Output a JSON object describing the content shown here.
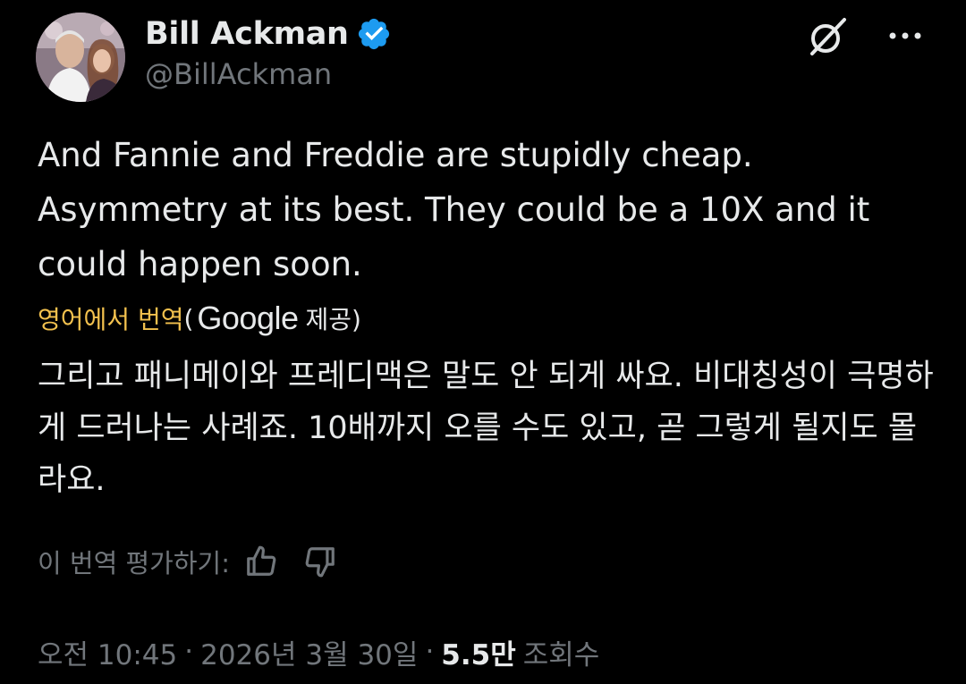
{
  "author": {
    "display_name": "Bill Ackman",
    "handle": "@BillAckman"
  },
  "tweet": {
    "text": "And Fannie and Freddie are stupidly cheap. Asymmetry at its best. They could be a 10X and it could happen soon."
  },
  "translation": {
    "label": "영어에서 번역",
    "paren_open": "(",
    "provider": "Google",
    "provider_suffix": "제공)",
    "text": "그리고 패니메이와 프레디맥은 말도 안 되게 싸요. 비대칭성이 극명하게 드러나는 사례죠. 10배까지 오를 수도 있고, 곧 그렇게 될지도 몰라요.",
    "rate_label": "이 번역 평가하기:"
  },
  "meta": {
    "time": "오전 10:45",
    "separator": "·",
    "date": "2026년 3월 30일",
    "views_count": "5.5만",
    "views_label": "조회수"
  },
  "colors": {
    "background": "#000000",
    "text": "#e7e9ea",
    "muted": "#71767b",
    "verified_badge": "#1d9bf0",
    "translate_label": "#f2c14e"
  },
  "icons": {
    "verified": "verified-badge-icon",
    "grok": "grok-icon",
    "more": "more-options-icon",
    "thumbs_up": "thumbs-up-icon",
    "thumbs_down": "thumbs-down-icon"
  }
}
